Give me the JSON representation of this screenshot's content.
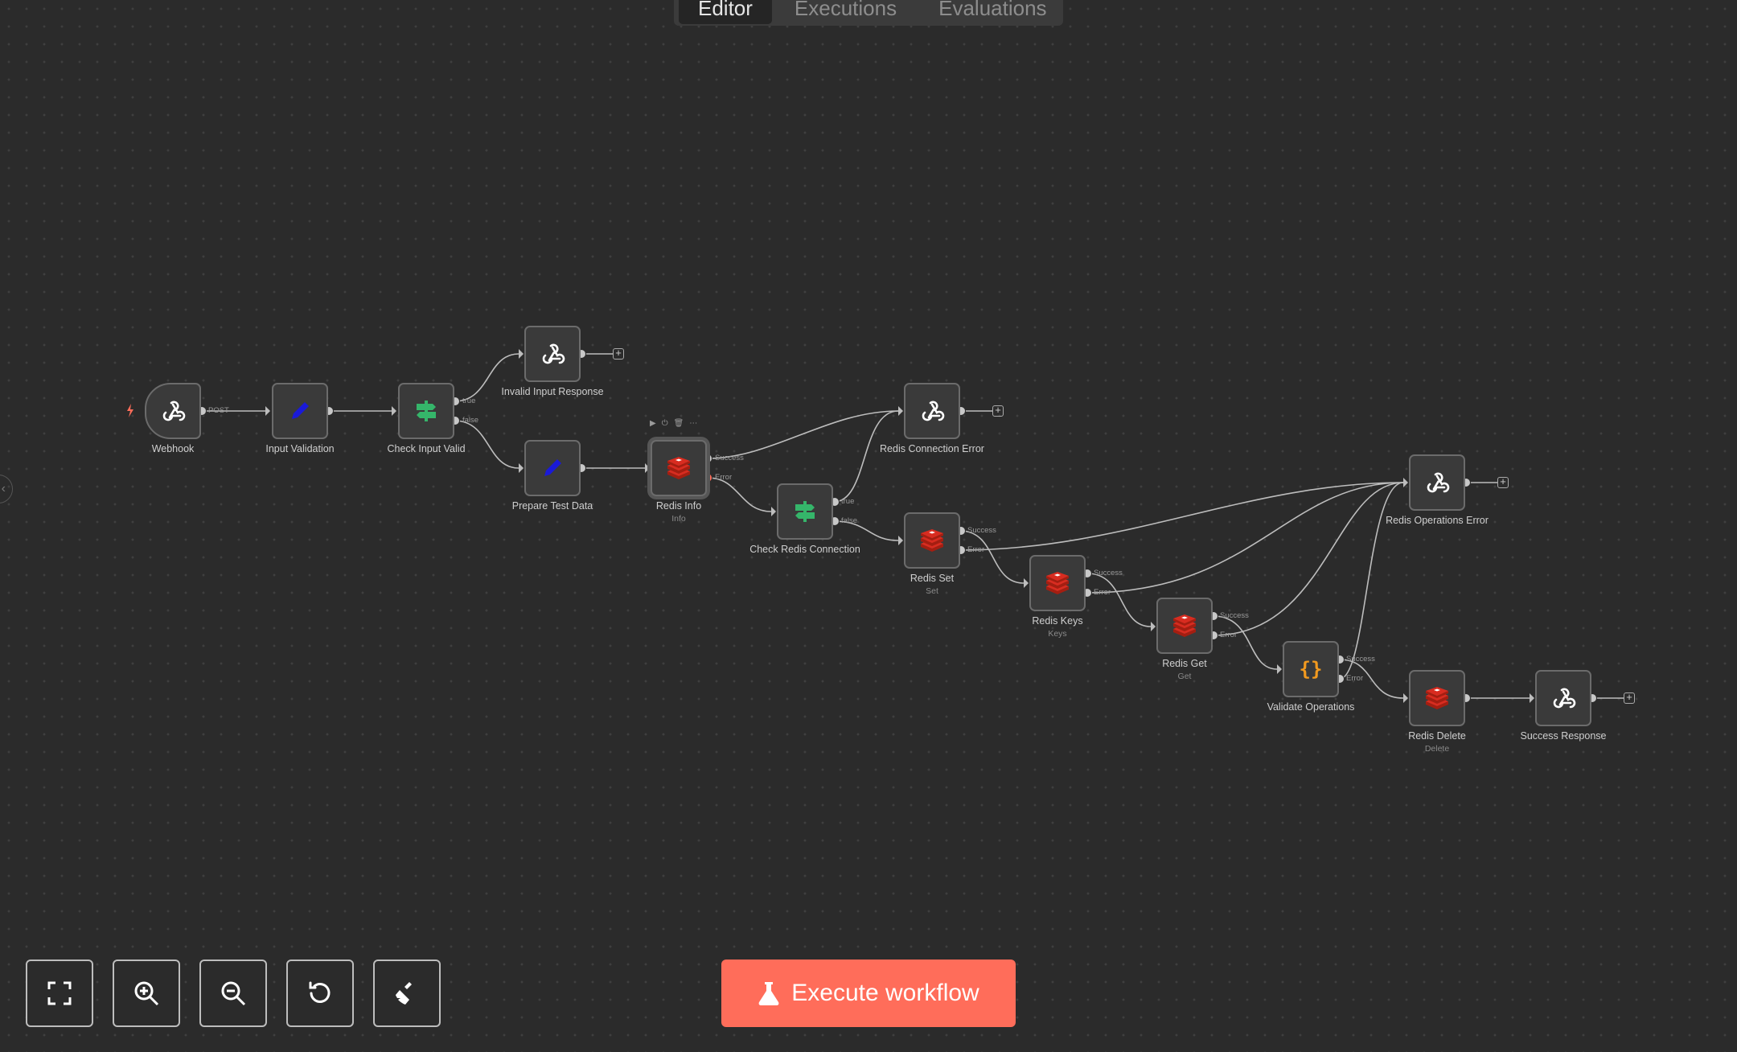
{
  "tabs": [
    {
      "label": "Editor",
      "active": true
    },
    {
      "label": "Executions",
      "active": false
    },
    {
      "label": "Evaluations",
      "active": false
    }
  ],
  "nodes": {
    "webhook": {
      "label": "Webhook",
      "icon": "webhook-icon"
    },
    "input_validation": {
      "label": "Input Validation",
      "icon": "pencil-icon"
    },
    "check_input_valid": {
      "label": "Check Input Valid",
      "icon": "if-signpost-icon"
    },
    "invalid_input_response": {
      "label": "Invalid Input Response",
      "icon": "webhook-icon"
    },
    "prepare_test_data": {
      "label": "Prepare Test Data",
      "icon": "pencil-icon"
    },
    "redis_info": {
      "label": "Redis Info",
      "sub": "Info",
      "icon": "redis-icon"
    },
    "redis_connection_error": {
      "label": "Redis Connection Error",
      "icon": "webhook-icon"
    },
    "check_redis_connection": {
      "label": "Check Redis Connection",
      "icon": "if-signpost-icon"
    },
    "redis_set": {
      "label": "Redis Set",
      "sub": "Set",
      "icon": "redis-icon"
    },
    "redis_keys": {
      "label": "Redis Keys",
      "sub": "Keys",
      "icon": "redis-icon"
    },
    "redis_get": {
      "label": "Redis Get",
      "sub": "Get",
      "icon": "redis-icon"
    },
    "validate_operations": {
      "label": "Validate Operations",
      "icon": "code-braces-icon"
    },
    "redis_operations_error": {
      "label": "Redis Operations Error",
      "icon": "webhook-icon"
    },
    "redis_delete": {
      "label": "Redis Delete",
      "sub": "Delete",
      "icon": "redis-icon"
    },
    "success_response": {
      "label": "Success Response",
      "icon": "webhook-icon"
    }
  },
  "port_labels": {
    "post": "POST",
    "true": "true",
    "false": "false",
    "success": "Success",
    "error": "Error"
  },
  "toolbar": {
    "buttons": [
      "fit-view-icon",
      "zoom-in-icon",
      "zoom-out-icon",
      "reset-zoom-icon",
      "tidy-up-icon"
    ],
    "execute_label": "Execute workflow"
  },
  "colors": {
    "canvas": "#2b2b2b",
    "accent": "#ff6d5a",
    "node_border": "#6b6b6b",
    "edge": "#bdbdbd",
    "if_green": "#35b56a",
    "redis_red": "#d82c20",
    "set_blue": "#1a1ad8",
    "code_orange": "#f29a1f",
    "error_port": "#ff6d5a"
  }
}
